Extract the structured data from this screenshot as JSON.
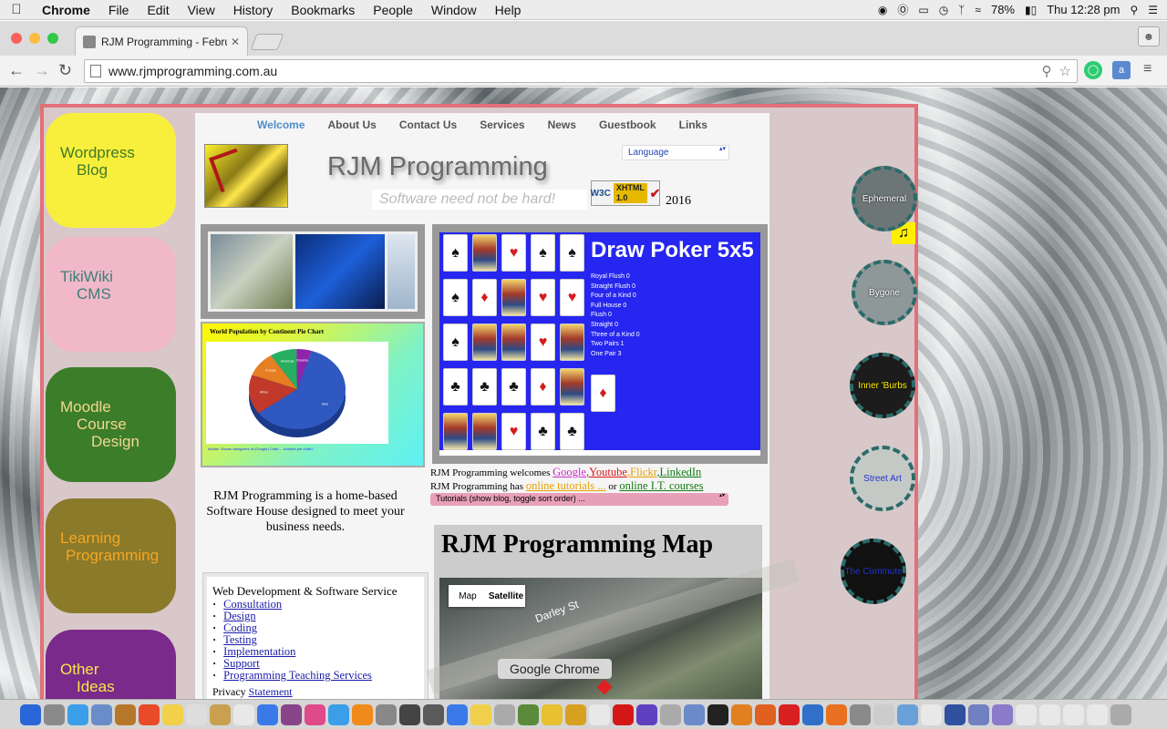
{
  "menubar": {
    "app": "Chrome",
    "items": [
      "File",
      "Edit",
      "View",
      "History",
      "Bookmarks",
      "People",
      "Window",
      "Help"
    ],
    "battery": "78%",
    "clock": "Thu 12:28 pm"
  },
  "browser": {
    "tab_title": "RJM Programming - Febru",
    "url": "www.rjmprogramming.com.au",
    "tooltip": "Google Chrome"
  },
  "site": {
    "nav": [
      "Welcome",
      "About Us",
      "Contact Us",
      "Services",
      "News",
      "Guestbook",
      "Links"
    ],
    "title": "RJM Programming",
    "tagline": "Software need not be hard!",
    "language_label": "Language",
    "w3c": "W3C",
    "xhtml": "XHTML 1.0",
    "year": "2016",
    "left_nav": [
      {
        "l1": "Wordpress",
        "l2": "Blog",
        "bg": "#f7ef3c",
        "fg": "#3f7a2a"
      },
      {
        "l1": "TikiWiki",
        "l2": "CMS",
        "bg": "#f0b8c8",
        "fg": "#3d7f7a"
      },
      {
        "l1": "Moodle",
        "l2": "Course",
        "l3": "Design",
        "bg": "#3c7d2a",
        "fg": "#f0d890"
      },
      {
        "l1": "Learning",
        "l2": "Programming",
        "bg": "#8b7a2a",
        "fg": "#f5a623"
      },
      {
        "l1": "Other",
        "l2": "Ideas",
        "bg": "#7a2a8a",
        "fg": "#f7e64a"
      }
    ],
    "right_circles": [
      {
        "label": "Ephemeral",
        "color": "#ffffff"
      },
      {
        "label": "Bygone",
        "color": "#ffffff"
      },
      {
        "label": "Inner 'Burbs",
        "color": "#ffef00"
      },
      {
        "label": "Street Art",
        "color": "#2233cc"
      },
      {
        "label": "The Commute",
        "color": "#2233cc"
      }
    ],
    "pie_title": "World Population by Continent Pie Chart",
    "pie_link": "Mobile: Shows categories of (Google) Chart ... Another pie chart?",
    "pie_slices": [
      {
        "name": "Asia",
        "value": 60,
        "color": "#2f58c0"
      },
      {
        "name": "Africa",
        "value": 16,
        "color": "#c0392b"
      },
      {
        "name": "Europe",
        "value": 10,
        "color": "#e67e22"
      },
      {
        "name": "Americas",
        "value": 9,
        "color": "#27ae60"
      },
      {
        "name": "Oceania",
        "value": 5,
        "color": "#8e24aa"
      }
    ],
    "poker_title": "Draw Poker 5x5",
    "poker_stats": [
      "Royal Flush 0",
      "Straight Flush 0",
      "Four of a Kind 0",
      "Full House 0",
      "Flush 0",
      "Straight 0",
      "Three of a Kind 0",
      "Two Pairs 1",
      "One Pair 3"
    ],
    "poker_cards": [
      [
        "♠",
        "F",
        "♥",
        "♠",
        "♠"
      ],
      [
        "♠",
        "♦",
        "F",
        "♥",
        "♥"
      ],
      [
        "♠",
        "F",
        "F",
        "♥",
        "F"
      ],
      [
        "♣",
        "♣",
        "♣",
        "♦",
        "F"
      ],
      [
        "F",
        "F",
        "♥",
        "♣",
        "♣"
      ]
    ],
    "poker_extra_card": "♦",
    "intro": "RJM Programming is a home-based Software House designed to meet your business needs.",
    "welcome_line1": "RJM Programming welcomes",
    "welcome_links": [
      {
        "text": "Google",
        "color": "#cc2bcc"
      },
      {
        "text": ",Youtube",
        "color": "#d81818"
      },
      {
        "text": ",Flickr",
        "color": "#e8a000"
      },
      {
        "text": ",LinkedIn",
        "color": "#137a13"
      }
    ],
    "welcome_line2_prefix": "RJM Programming has",
    "welcome_line2_link1": "online tutorials ...",
    "welcome_line2_mid": "or",
    "welcome_line2_link2": "online I.T. courses",
    "tutorials_select": "Tutorials (show blog, toggle sort order) ...",
    "services_heading": "Web Development & Software Service",
    "services": [
      "Consultation",
      "Design",
      "Coding",
      "Testing",
      "Implementation",
      "Support",
      "Programming Teaching Services"
    ],
    "privacy_prefix": "Privacy",
    "privacy_link": "Statement",
    "map_title": "RJM Programming Map",
    "map_type_map": "Map",
    "map_type_satellite": "Satellite",
    "street": "Darley St"
  },
  "dock_colors": [
    "#2a66d8",
    "#8a8a8a",
    "#3a9ee8",
    "#6a8cc8",
    "#b7772a",
    "#e84a2a",
    "#f2d04a",
    "#dddddd",
    "#c8a050",
    "#e8e8e8",
    "#3a7ae8",
    "#884488",
    "#e04a8a",
    "#3a9ee8",
    "#f08a1a",
    "#888888",
    "#444444",
    "#5a5a5a",
    "#3a7ae8",
    "#f0d04a",
    "#aaaaaa",
    "#5a8a3a",
    "#e8c030",
    "#d8a020",
    "#e8e8e8",
    "#d41818",
    "#6040c0",
    "#aaaaaa",
    "#6a8ac8",
    "#222222",
    "#e08020",
    "#e06020",
    "#d82020",
    "#3070c8",
    "#e87020",
    "#8a8a8a",
    "#cccccc",
    "#6aa0d8",
    "#e8e8e8",
    "#3050a0",
    "#7080c0",
    "#8a7ac8",
    "#e8e8e8",
    "#e8e8e8",
    "#e8e8e8",
    "#e8e8e8",
    "#aaaaaa"
  ]
}
